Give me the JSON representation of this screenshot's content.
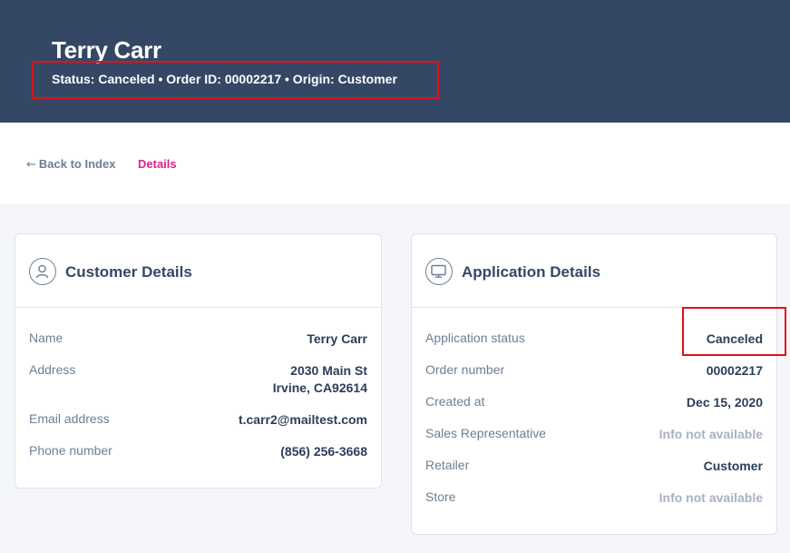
{
  "header": {
    "name": "Terry Carr",
    "meta": "Status: Canceled • Order ID: 00002217 • Origin: Customer"
  },
  "subnav": {
    "back_arrow": "←",
    "back_label": "Back to Index",
    "current_label": "Details"
  },
  "customer": {
    "title": "Customer Details",
    "icon": "user-icon",
    "rows": [
      {
        "label": "Name",
        "value": "Terry Carr"
      },
      {
        "label": "Address",
        "value_line1": "2030 Main St",
        "value_line2": "Irvine, CA92614"
      },
      {
        "label": "Email address",
        "value": "t.carr2@mailtest.com"
      },
      {
        "label": "Phone number",
        "value": "(856) 256-3668"
      }
    ]
  },
  "application": {
    "title": "Application Details",
    "icon": "monitor-icon",
    "rows": [
      {
        "label": "Application status",
        "value": "Canceled"
      },
      {
        "label": "Order number",
        "value": "00002217"
      },
      {
        "label": "Created at",
        "value": "Dec 15, 2020"
      },
      {
        "label": "Sales Representative",
        "value": "Info not available"
      },
      {
        "label": "Retailer",
        "value": "Customer"
      },
      {
        "label": "Store",
        "value": "Info not available"
      }
    ]
  },
  "colors": {
    "header_bg": "#344865",
    "accent": "#e0218a",
    "highlight": "#e0121b"
  }
}
